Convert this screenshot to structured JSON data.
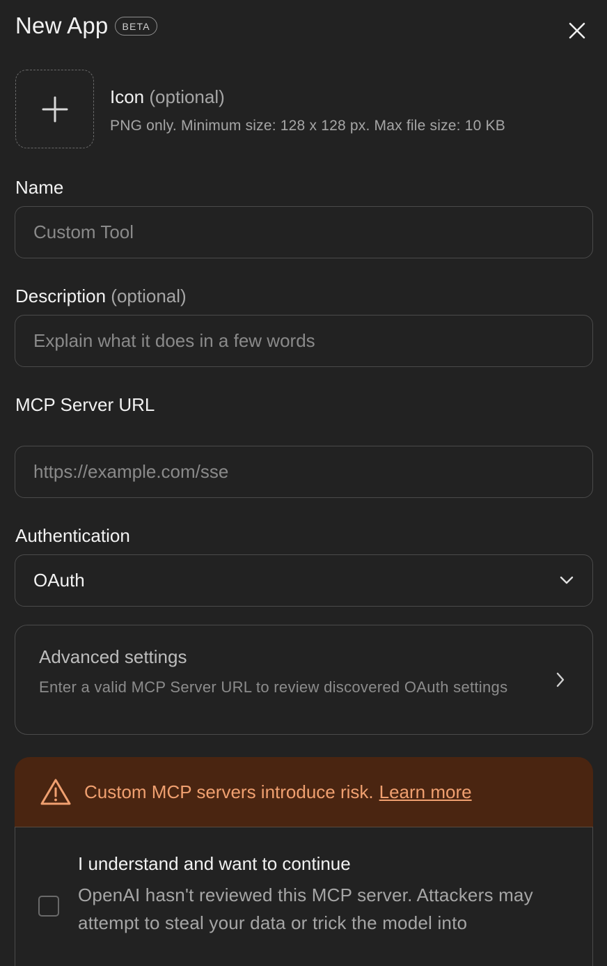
{
  "header": {
    "title": "New App",
    "badge": "BETA"
  },
  "icon": {
    "label": "Icon",
    "optional": "(optional)",
    "hint": "PNG only. Minimum size: 128 x 128 px. Max file size: 10 KB"
  },
  "name": {
    "label": "Name",
    "placeholder": "Custom Tool"
  },
  "description": {
    "label": "Description",
    "optional": "(optional)",
    "placeholder": "Explain what it does in a few words"
  },
  "server_url": {
    "label": "MCP Server URL",
    "placeholder": "https://example.com/sse"
  },
  "authentication": {
    "label": "Authentication",
    "value": "OAuth"
  },
  "advanced": {
    "title": "Advanced settings",
    "description": "Enter a valid MCP Server URL to review discovered OAuth settings"
  },
  "warning": {
    "text": "Custom MCP servers introduce risk.",
    "link": "Learn more",
    "color": "#f0a070",
    "background": "#4a2511"
  },
  "consent": {
    "title": "I understand and want to continue",
    "description": "OpenAI hasn't reviewed this MCP server. Attackers may attempt to steal your data or trick the model into"
  }
}
